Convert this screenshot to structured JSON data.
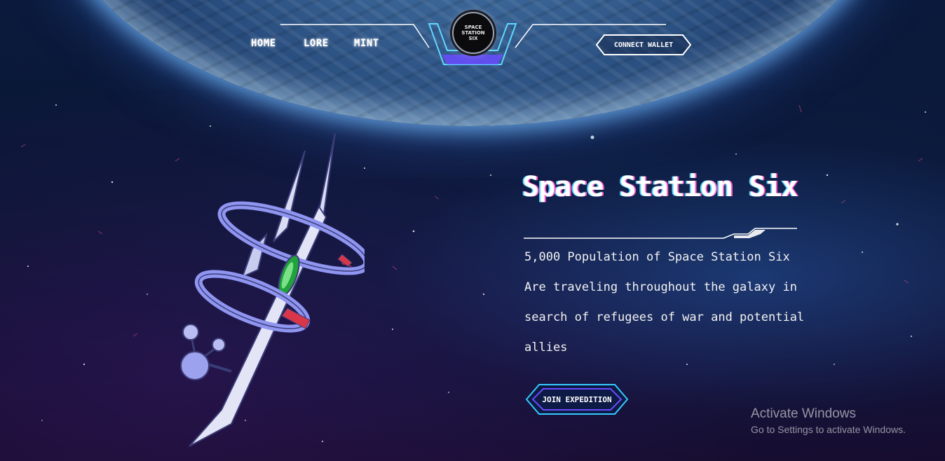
{
  "nav": {
    "links": [
      {
        "label": "HOME"
      },
      {
        "label": "LORE"
      },
      {
        "label": "MINT"
      }
    ],
    "logo": {
      "line1": "SPACE",
      "line2": "STATION",
      "line3": "SIX"
    },
    "connect_label": "CONNECT WALLET"
  },
  "hero": {
    "title": "Space Station Six",
    "description_lines": [
      "5,000 Population of Space Station Six",
      "Are traveling throughout the galaxy in",
      "search of refugees of war and potential",
      "allies"
    ],
    "cta_label": "JOIN EXPEDITION"
  },
  "overlay": {
    "title": "Activate Windows",
    "subtitle": "Go to Settings to activate Windows."
  },
  "colors": {
    "accent_cyan": "#35c9ff",
    "accent_purple": "#6a4cff",
    "station_lavender": "#8f95f0",
    "station_red": "#d9364a",
    "station_green": "#1fa33a"
  }
}
